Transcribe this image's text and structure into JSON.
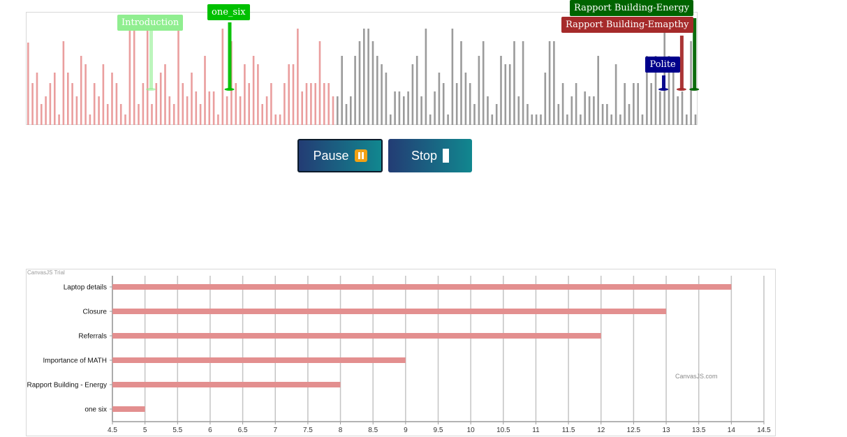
{
  "waveform": {
    "markers": [
      {
        "label": "Introduction",
        "color": "#90ee90",
        "position": 0.185
      },
      {
        "label": "one_six",
        "color": "#00c000",
        "position": 0.302
      },
      {
        "label": "Rapport Building-Energy",
        "color": "#006400",
        "position": 0.994
      },
      {
        "label": "Rapport Building-Emapthy",
        "color": "#a52a2a",
        "position": 0.975
      },
      {
        "label": "Polite",
        "color": "#00008b",
        "position": 0.948
      }
    ],
    "played_color": "#e89393",
    "unplayed_color": "#8a8a8a",
    "progress": 0.458
  },
  "controls": {
    "pause_label": "Pause",
    "pause_icon": "pause-button-icon",
    "stop_label": "Stop",
    "stop_icon": "stop-bar-icon"
  },
  "chart_watermark": "CanvasJS Trial",
  "chart_credit": "CanvasJS.com",
  "chart_data": {
    "type": "bar",
    "orientation": "horizontal",
    "categories": [
      "Laptop details",
      "Closure",
      "Referrals",
      "Importance of MATH",
      "Rapport Building - Energy",
      "one six"
    ],
    "values": [
      14,
      13,
      12,
      9,
      8,
      5
    ],
    "xlim": [
      4.5,
      14.5
    ],
    "x_ticks": [
      "4.5",
      "5",
      "5.5",
      "6",
      "6.5",
      "7",
      "7.5",
      "8",
      "8.5",
      "9",
      "9.5",
      "10",
      "10.5",
      "11",
      "11.5",
      "12",
      "12.5",
      "13",
      "13.5",
      "14",
      "14.5"
    ],
    "bar_color": "#e38f8f",
    "grid": true,
    "title": "",
    "xlabel": "",
    "ylabel": ""
  }
}
